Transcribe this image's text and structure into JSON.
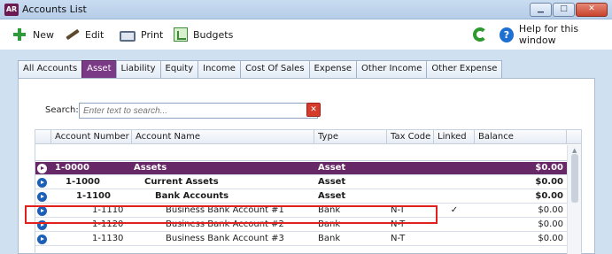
{
  "window": {
    "title": "Accounts List",
    "logo": "AR"
  },
  "toolbar": {
    "new_label": "New",
    "edit_label": "Edit",
    "print_label": "Print",
    "budgets_label": "Budgets",
    "help_label": "Help for this window",
    "help_glyph": "?"
  },
  "tabs": [
    "All Accounts",
    "Asset",
    "Liability",
    "Equity",
    "Income",
    "Cost Of Sales",
    "Expense",
    "Other Income",
    "Other Expense"
  ],
  "active_tab": "Asset",
  "search": {
    "label": "Search:",
    "placeholder": "Enter text to search..."
  },
  "columns": [
    "Account Number",
    "Account Name",
    "Type",
    "Tax Code",
    "Linked",
    "Balance"
  ],
  "rows": [
    {
      "number": "1-0000",
      "name": "Assets",
      "type": "Asset",
      "tax": "",
      "linked": "",
      "balance": "$0.00",
      "style": "group"
    },
    {
      "number": "1-1000",
      "name": "Current Assets",
      "type": "Asset",
      "tax": "",
      "linked": "",
      "balance": "$0.00",
      "style": "bold"
    },
    {
      "number": "1-1100",
      "name": "Bank Accounts",
      "type": "Asset",
      "tax": "",
      "linked": "",
      "balance": "$0.00",
      "style": "bold"
    },
    {
      "number": "1-1110",
      "name": "Business Bank Account #1",
      "type": "Bank",
      "tax": "N-T",
      "linked": "✓",
      "balance": "$0.00",
      "style": "normal"
    },
    {
      "number": "1-1120",
      "name": "Business Bank Account #2",
      "type": "Bank",
      "tax": "N-T",
      "linked": "",
      "balance": "$0.00",
      "style": "normal"
    },
    {
      "number": "1-1130",
      "name": "Business Bank Account #3",
      "type": "Bank",
      "tax": "N-T",
      "linked": "",
      "balance": "$0.00",
      "style": "normal"
    }
  ],
  "colors": {
    "brand": "#672867",
    "active_tab": "#7a3a86",
    "highlight": "#e0201c"
  }
}
